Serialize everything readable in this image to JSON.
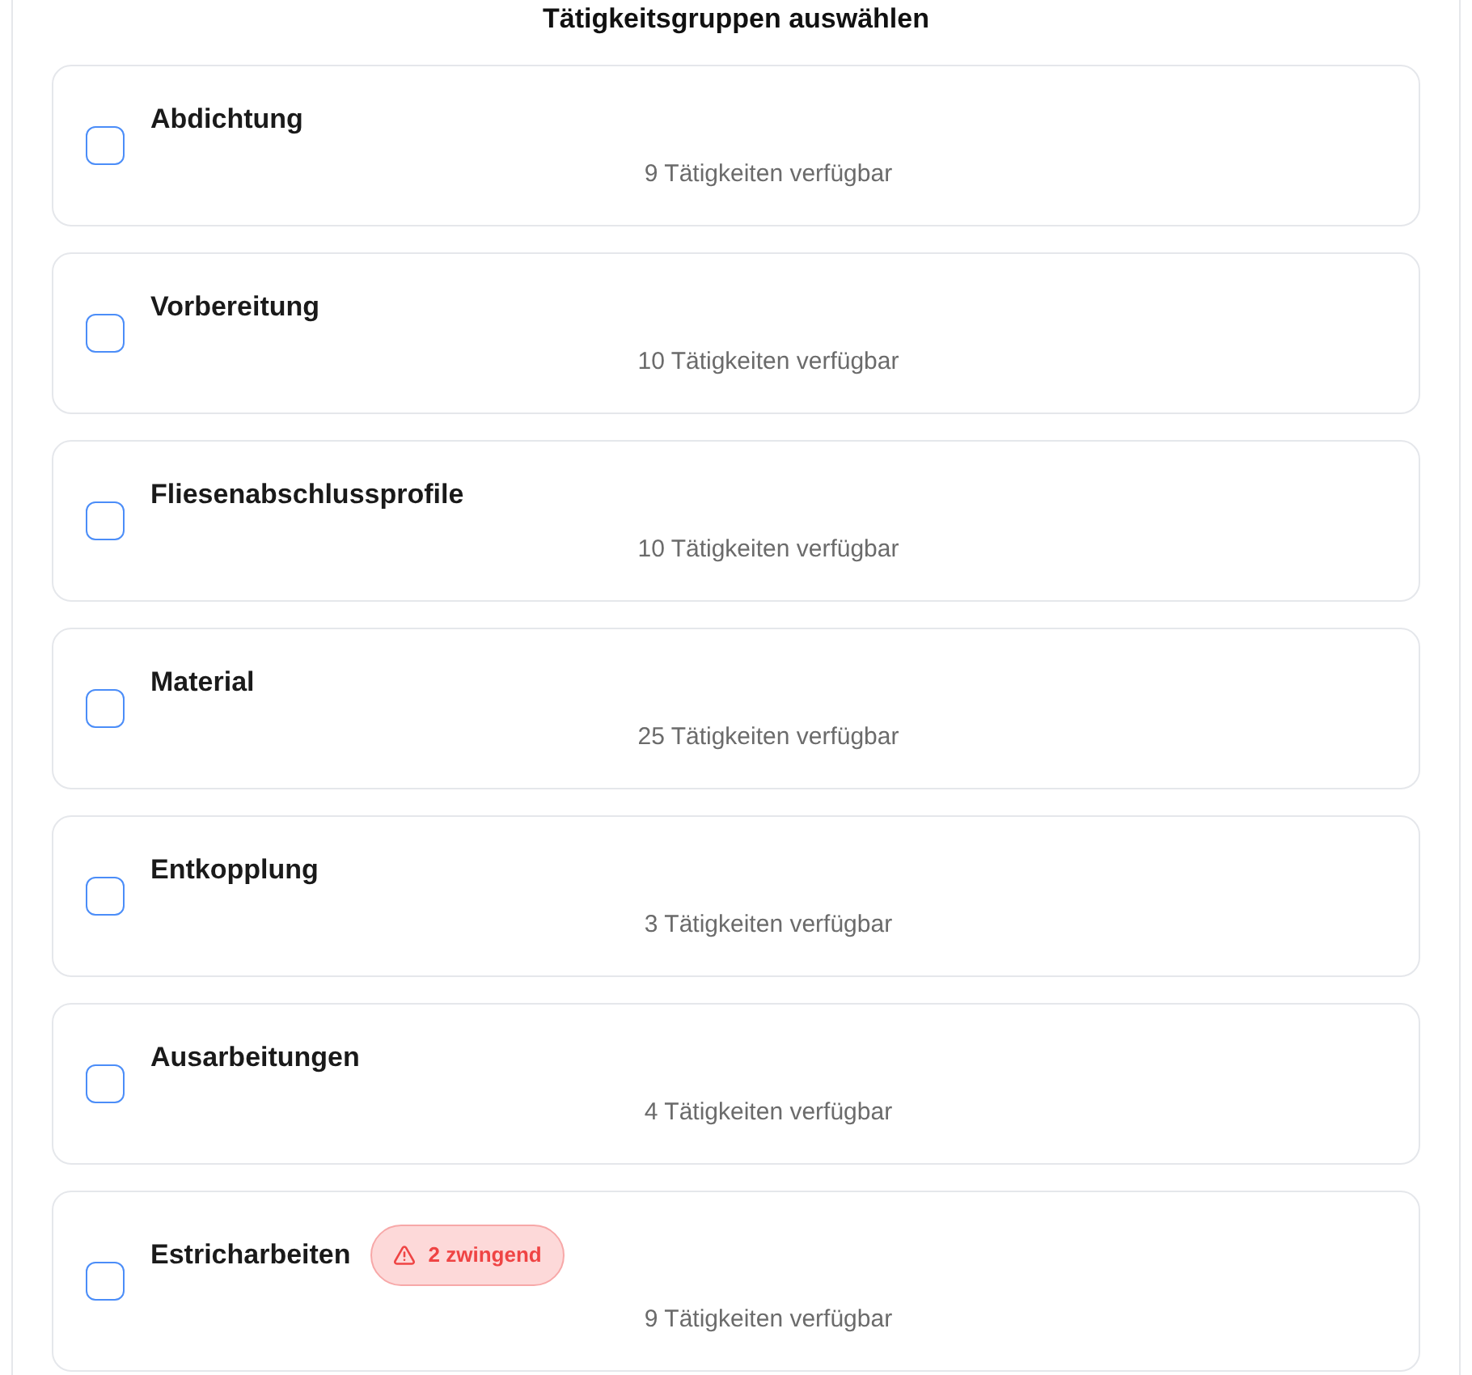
{
  "title": "Tätigkeitsgruppen auswählen",
  "groups": [
    {
      "name": "Abdichtung",
      "checked": false,
      "count": "9 Tätigkeiten verfügbar"
    },
    {
      "name": "Vorbereitung",
      "checked": false,
      "count": "10 Tätigkeiten verfügbar"
    },
    {
      "name": "Fliesenabschlussprofile",
      "checked": false,
      "count": "10 Tätigkeiten verfügbar"
    },
    {
      "name": "Material",
      "checked": false,
      "count": "25 Tätigkeiten verfügbar"
    },
    {
      "name": "Entkopplung",
      "checked": false,
      "count": "3 Tätigkeiten verfügbar"
    },
    {
      "name": "Ausarbeitungen",
      "checked": false,
      "count": "4 Tätigkeiten verfügbar"
    },
    {
      "name": "Estricharbeiten",
      "checked": false,
      "count": "9 Tätigkeiten verfügbar",
      "badge": {
        "kind": "warning",
        "label": "2 zwingend"
      }
    }
  ]
}
